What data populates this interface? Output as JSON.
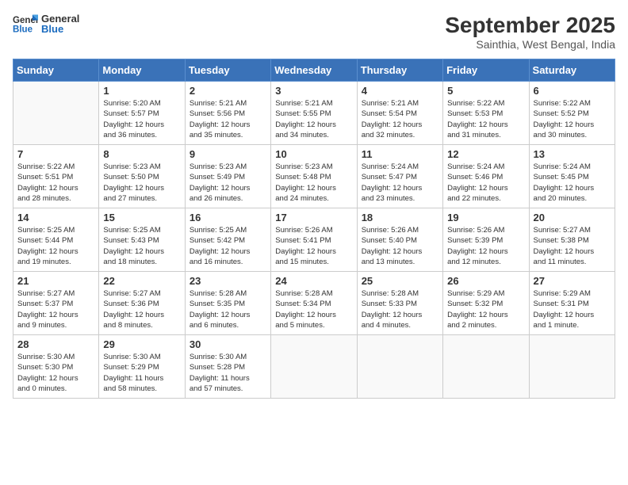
{
  "header": {
    "logo_general": "General",
    "logo_blue": "Blue",
    "month_year": "September 2025",
    "location": "Sainthia, West Bengal, India"
  },
  "days_of_week": [
    "Sunday",
    "Monday",
    "Tuesday",
    "Wednesday",
    "Thursday",
    "Friday",
    "Saturday"
  ],
  "weeks": [
    [
      {
        "day": "",
        "info": ""
      },
      {
        "day": "1",
        "info": "Sunrise: 5:20 AM\nSunset: 5:57 PM\nDaylight: 12 hours\nand 36 minutes."
      },
      {
        "day": "2",
        "info": "Sunrise: 5:21 AM\nSunset: 5:56 PM\nDaylight: 12 hours\nand 35 minutes."
      },
      {
        "day": "3",
        "info": "Sunrise: 5:21 AM\nSunset: 5:55 PM\nDaylight: 12 hours\nand 34 minutes."
      },
      {
        "day": "4",
        "info": "Sunrise: 5:21 AM\nSunset: 5:54 PM\nDaylight: 12 hours\nand 32 minutes."
      },
      {
        "day": "5",
        "info": "Sunrise: 5:22 AM\nSunset: 5:53 PM\nDaylight: 12 hours\nand 31 minutes."
      },
      {
        "day": "6",
        "info": "Sunrise: 5:22 AM\nSunset: 5:52 PM\nDaylight: 12 hours\nand 30 minutes."
      }
    ],
    [
      {
        "day": "7",
        "info": "Sunrise: 5:22 AM\nSunset: 5:51 PM\nDaylight: 12 hours\nand 28 minutes."
      },
      {
        "day": "8",
        "info": "Sunrise: 5:23 AM\nSunset: 5:50 PM\nDaylight: 12 hours\nand 27 minutes."
      },
      {
        "day": "9",
        "info": "Sunrise: 5:23 AM\nSunset: 5:49 PM\nDaylight: 12 hours\nand 26 minutes."
      },
      {
        "day": "10",
        "info": "Sunrise: 5:23 AM\nSunset: 5:48 PM\nDaylight: 12 hours\nand 24 minutes."
      },
      {
        "day": "11",
        "info": "Sunrise: 5:24 AM\nSunset: 5:47 PM\nDaylight: 12 hours\nand 23 minutes."
      },
      {
        "day": "12",
        "info": "Sunrise: 5:24 AM\nSunset: 5:46 PM\nDaylight: 12 hours\nand 22 minutes."
      },
      {
        "day": "13",
        "info": "Sunrise: 5:24 AM\nSunset: 5:45 PM\nDaylight: 12 hours\nand 20 minutes."
      }
    ],
    [
      {
        "day": "14",
        "info": "Sunrise: 5:25 AM\nSunset: 5:44 PM\nDaylight: 12 hours\nand 19 minutes."
      },
      {
        "day": "15",
        "info": "Sunrise: 5:25 AM\nSunset: 5:43 PM\nDaylight: 12 hours\nand 18 minutes."
      },
      {
        "day": "16",
        "info": "Sunrise: 5:25 AM\nSunset: 5:42 PM\nDaylight: 12 hours\nand 16 minutes."
      },
      {
        "day": "17",
        "info": "Sunrise: 5:26 AM\nSunset: 5:41 PM\nDaylight: 12 hours\nand 15 minutes."
      },
      {
        "day": "18",
        "info": "Sunrise: 5:26 AM\nSunset: 5:40 PM\nDaylight: 12 hours\nand 13 minutes."
      },
      {
        "day": "19",
        "info": "Sunrise: 5:26 AM\nSunset: 5:39 PM\nDaylight: 12 hours\nand 12 minutes."
      },
      {
        "day": "20",
        "info": "Sunrise: 5:27 AM\nSunset: 5:38 PM\nDaylight: 12 hours\nand 11 minutes."
      }
    ],
    [
      {
        "day": "21",
        "info": "Sunrise: 5:27 AM\nSunset: 5:37 PM\nDaylight: 12 hours\nand 9 minutes."
      },
      {
        "day": "22",
        "info": "Sunrise: 5:27 AM\nSunset: 5:36 PM\nDaylight: 12 hours\nand 8 minutes."
      },
      {
        "day": "23",
        "info": "Sunrise: 5:28 AM\nSunset: 5:35 PM\nDaylight: 12 hours\nand 6 minutes."
      },
      {
        "day": "24",
        "info": "Sunrise: 5:28 AM\nSunset: 5:34 PM\nDaylight: 12 hours\nand 5 minutes."
      },
      {
        "day": "25",
        "info": "Sunrise: 5:28 AM\nSunset: 5:33 PM\nDaylight: 12 hours\nand 4 minutes."
      },
      {
        "day": "26",
        "info": "Sunrise: 5:29 AM\nSunset: 5:32 PM\nDaylight: 12 hours\nand 2 minutes."
      },
      {
        "day": "27",
        "info": "Sunrise: 5:29 AM\nSunset: 5:31 PM\nDaylight: 12 hours\nand 1 minute."
      }
    ],
    [
      {
        "day": "28",
        "info": "Sunrise: 5:30 AM\nSunset: 5:30 PM\nDaylight: 12 hours\nand 0 minutes."
      },
      {
        "day": "29",
        "info": "Sunrise: 5:30 AM\nSunset: 5:29 PM\nDaylight: 11 hours\nand 58 minutes."
      },
      {
        "day": "30",
        "info": "Sunrise: 5:30 AM\nSunset: 5:28 PM\nDaylight: 11 hours\nand 57 minutes."
      },
      {
        "day": "",
        "info": ""
      },
      {
        "day": "",
        "info": ""
      },
      {
        "day": "",
        "info": ""
      },
      {
        "day": "",
        "info": ""
      }
    ]
  ]
}
